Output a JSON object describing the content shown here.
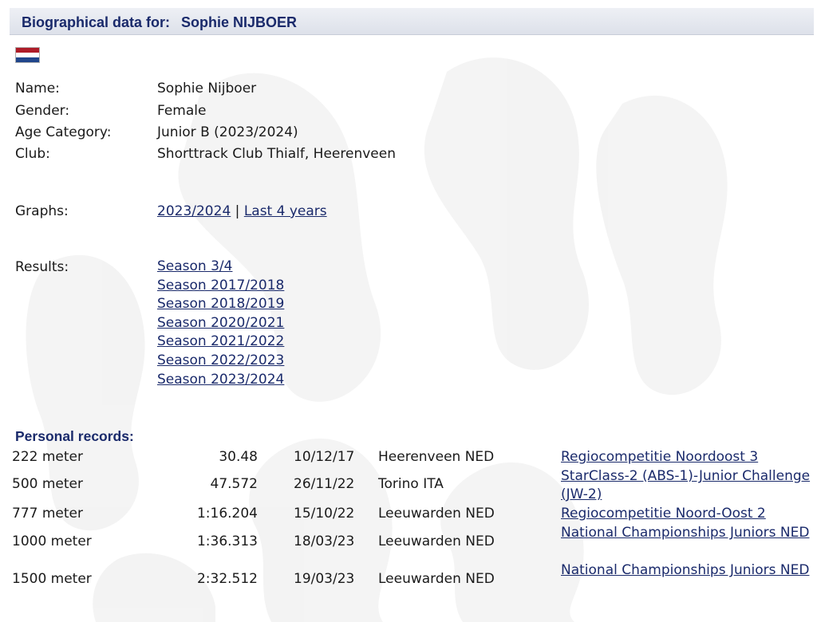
{
  "header": {
    "label": "Biographical data for:",
    "athlete": "Sophie NIJBOER"
  },
  "flag": {
    "icon": "netherlands-flag-icon",
    "colors": [
      "#ae1c28",
      "#ffffff",
      "#21468b"
    ]
  },
  "bio": {
    "name_label": "Name:",
    "name": "Sophie Nijboer",
    "gender_label": "Gender:",
    "gender": "Female",
    "age_label": "Age Category:",
    "age": "Junior B (2023/2024)",
    "club_label": "Club:",
    "club": "Shorttrack Club Thialf, Heerenveen"
  },
  "graphs": {
    "label": "Graphs:",
    "links": [
      "2023/2024",
      "Last 4 years"
    ],
    "separator": "|"
  },
  "results": {
    "label": "Results:",
    "seasons": [
      "Season 3/4",
      "Season 2017/2018",
      "Season 2018/2019",
      "Season 2020/2021",
      "Season 2021/2022",
      "Season 2022/2023",
      "Season 2023/2024"
    ]
  },
  "personal_records": {
    "title": "Personal records:",
    "rows": [
      {
        "distance": "222 meter",
        "time": "30.48",
        "date": "10/12/17",
        "venue": "Heerenveen NED",
        "competition": "Regiocompetitie Noordoost 3"
      },
      {
        "distance": "500 meter",
        "time": "47.572",
        "date": "26/11/22",
        "venue": "Torino ITA",
        "competition": "StarClass-2 (ABS-1)-Junior Challenge (JW-2)"
      },
      {
        "distance": "777 meter",
        "time": "1:16.204",
        "date": "15/10/22",
        "venue": "Leeuwarden NED",
        "competition": "Regiocompetitie Noord-Oost 2"
      },
      {
        "distance": "1000 meter",
        "time": "1:36.313",
        "date": "18/03/23",
        "venue": "Leeuwarden NED",
        "competition": "National Championships Juniors NED"
      },
      {
        "distance": "1500 meter",
        "time": "2:32.512",
        "date": "19/03/23",
        "venue": "Leeuwarden NED",
        "competition": "National Championships Juniors NED"
      }
    ]
  },
  "colors": {
    "link": "#1a2a6b",
    "header_bg": "#e4e7ee",
    "text": "#1a1a1a"
  }
}
